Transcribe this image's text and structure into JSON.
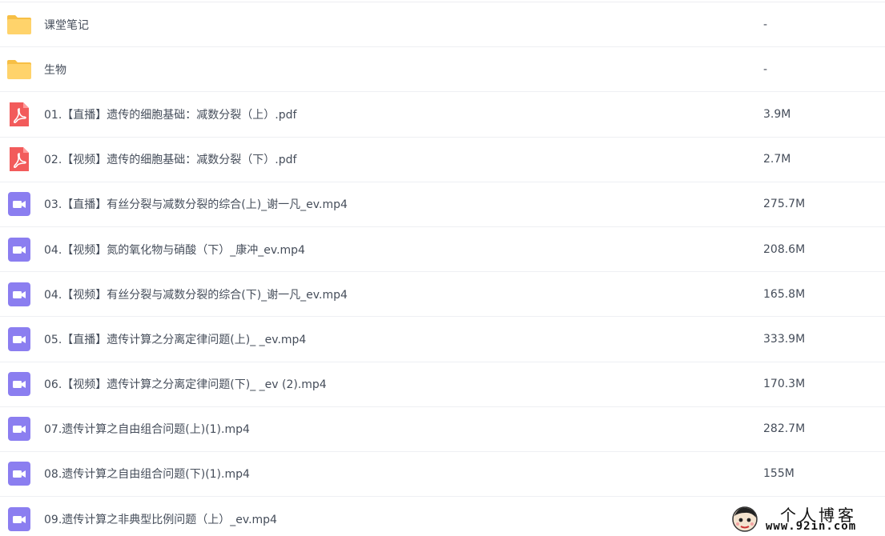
{
  "files": [
    {
      "type": "folder",
      "icon": "folder-icon",
      "name": "课堂笔记",
      "size": "-"
    },
    {
      "type": "folder",
      "icon": "folder-icon",
      "name": "生物",
      "size": "-"
    },
    {
      "type": "pdf",
      "icon": "pdf-icon",
      "name": "01.【直播】遗传的细胞基础：减数分裂（上）.pdf",
      "size": "3.9M"
    },
    {
      "type": "pdf",
      "icon": "pdf-icon",
      "name": "02.【视频】遗传的细胞基础：减数分裂（下）.pdf",
      "size": "2.7M"
    },
    {
      "type": "video",
      "icon": "video-icon",
      "name": "03.【直播】有丝分裂与减数分裂的综合(上)_谢一凡_ev.mp4",
      "size": "275.7M"
    },
    {
      "type": "video",
      "icon": "video-icon",
      "name": "04.【视频】氮的氧化物与硝酸（下）_康冲_ev.mp4",
      "size": "208.6M"
    },
    {
      "type": "video",
      "icon": "video-icon",
      "name": "04.【视频】有丝分裂与减数分裂的综合(下)_谢一凡_ev.mp4",
      "size": "165.8M"
    },
    {
      "type": "video",
      "icon": "video-icon",
      "name": "05.【直播】遗传计算之分离定律问题(上)_ _ev.mp4",
      "size": "333.9M"
    },
    {
      "type": "video",
      "icon": "video-icon",
      "name": "06.【视频】遗传计算之分离定律问题(下)_ _ev (2).mp4",
      "size": "170.3M"
    },
    {
      "type": "video",
      "icon": "video-icon",
      "name": "07.遗传计算之自由组合问题(上)(1).mp4",
      "size": "282.7M"
    },
    {
      "type": "video",
      "icon": "video-icon",
      "name": "08.遗传计算之自由组合问题(下)(1).mp4",
      "size": "155M"
    },
    {
      "type": "video",
      "icon": "video-icon",
      "name": "09.遗传计算之非典型比例问题（上）_ev.mp4",
      "size": ""
    }
  ],
  "colors": {
    "folder": "#ffd36b",
    "folder_tab": "#f7bf45",
    "pdf": "#f25b5b",
    "video": "#8b7ef0",
    "text": "#454d5a"
  },
  "watermark": {
    "title": "个人博客",
    "url": "www.92in.com"
  }
}
